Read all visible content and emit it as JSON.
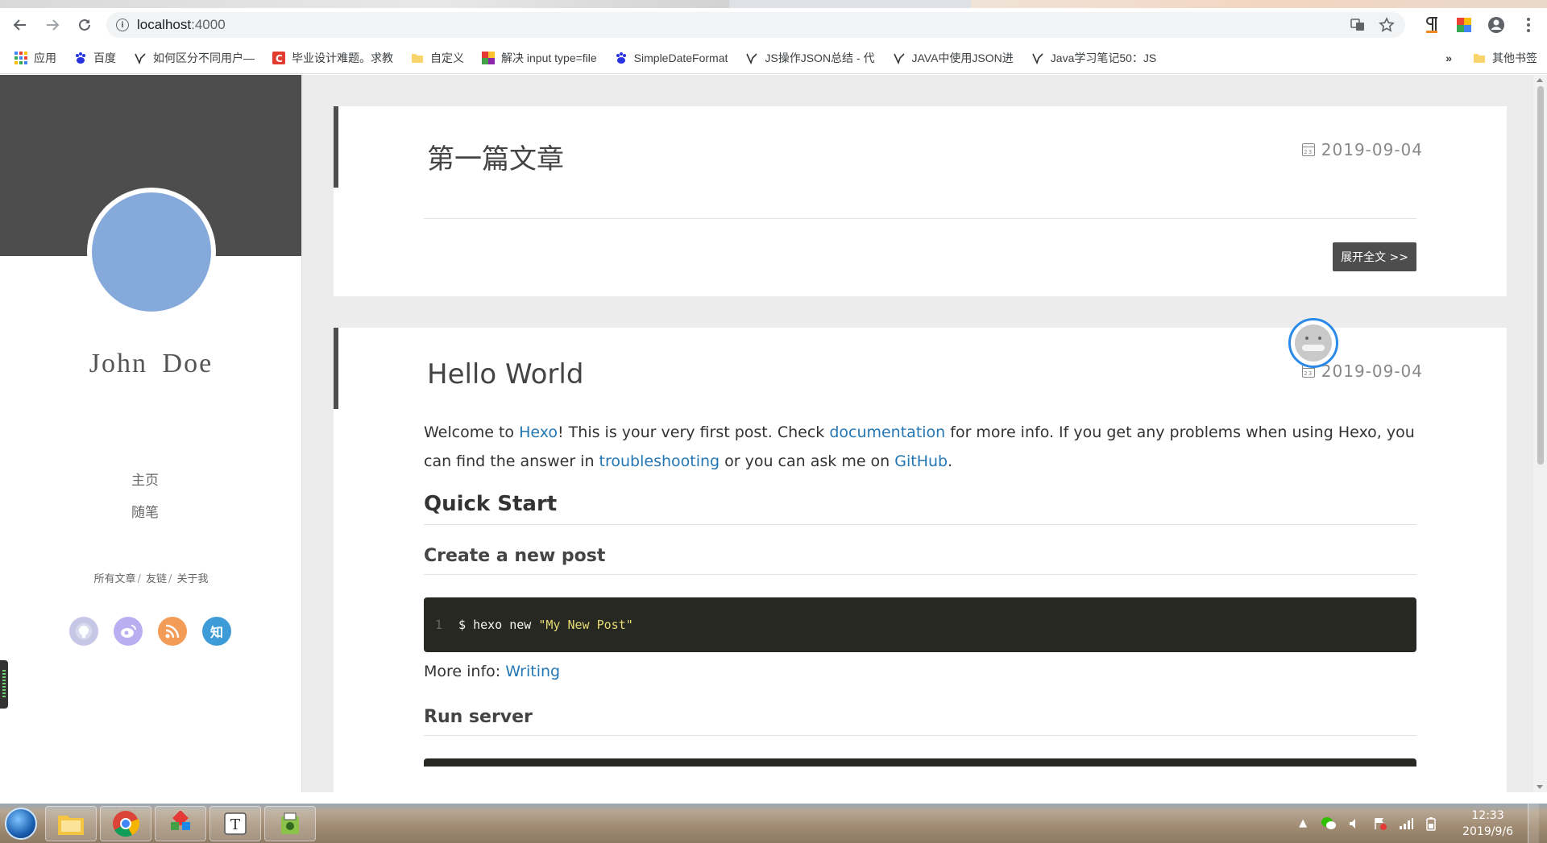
{
  "browser": {
    "url_host": "localhost",
    "url_port": ":4000",
    "bookmarks": [
      {
        "icon": "apps-icon",
        "label": "应用"
      },
      {
        "icon": "baidu-icon",
        "label": "百度"
      },
      {
        "icon": "site-icon",
        "label": "如何区分不同用户—"
      },
      {
        "icon": "csdn-icon",
        "label": "毕业设计难题。求教"
      },
      {
        "icon": "folder-icon",
        "label": "自定义"
      },
      {
        "icon": "site-icon",
        "label": "解决 input type=file"
      },
      {
        "icon": "baidu-icon",
        "label": "SimpleDateFormat"
      },
      {
        "icon": "site-icon",
        "label": "JS操作JSON总结 - 代"
      },
      {
        "icon": "site-icon",
        "label": "JAVA中使用JSON进"
      },
      {
        "icon": "site-icon",
        "label": "Java学习笔记50：JS"
      }
    ],
    "more": "»",
    "other_bookmarks": "其他书签"
  },
  "sidebar": {
    "author": "John  Doe",
    "nav": [
      "主页",
      "随笔"
    ],
    "links": [
      "所有文章",
      "友链",
      "关于我"
    ],
    "socials": [
      {
        "icon": "github-icon",
        "color": "#c6c6e6",
        "glyph": "●"
      },
      {
        "icon": "weibo-icon",
        "color": "#b8aef0",
        "glyph": "◉"
      },
      {
        "icon": "rss-icon",
        "color": "#f39c58",
        "glyph": "◗"
      },
      {
        "icon": "zhihu-icon",
        "color": "#3d9bd8",
        "glyph": "知"
      }
    ]
  },
  "posts": [
    {
      "title": "第一篇文章",
      "date": "2019-09-04",
      "expand_label": "展开全文 >>"
    },
    {
      "title": "Hello World",
      "date": "2019-09-04",
      "intro": {
        "t1": "Welcome to ",
        "l1": "Hexo",
        "t2": "! This is your very first post. Check ",
        "l2": "documentation",
        "t3": " for more info. If you get any problems when using Hexo, you can find the answer in ",
        "l3": "troubleshooting",
        "t4": " or you can ask me on ",
        "l4": "GitHub",
        "t5": "."
      },
      "h_quick_start": "Quick Start",
      "h_new_post": "Create a new post",
      "code_line_no": "1",
      "code_cmd": "$ hexo new ",
      "code_str": "\"My New Post\"",
      "more_info_label": "More info: ",
      "more_info_link": "Writing",
      "h_run_server": "Run server"
    }
  ],
  "taskbar": {
    "time": "12:33",
    "date": "2019/9/6"
  }
}
